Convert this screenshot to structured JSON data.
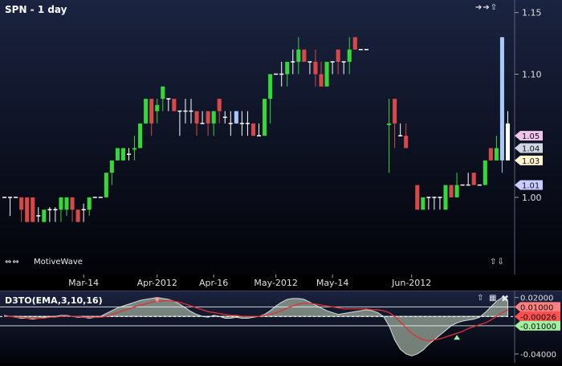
{
  "header": {
    "title": "SPN - 1 day",
    "brand": "MotiveWave"
  },
  "indicator": {
    "title": "D3TO(EMA,3,10,16)"
  },
  "icons": {
    "nav_left_right": "double-arrow-left-right-icon",
    "nav_up_down": "arrow-up-down-icon",
    "panel_close": "close-icon",
    "panel_maximize": "maximize-icon"
  },
  "colors": {
    "background_top": "#1a2340",
    "background_bottom": "#020308",
    "up_candle": "#37d63a",
    "down_candle": "#d94848",
    "highlight_candle": "#a8c8f8",
    "axis_text": "#e0e0e0",
    "indicator_fill": "#9aa89a",
    "indicator_line": "#e03030",
    "indicator_band": "#ffffff"
  },
  "chart_data": [
    {
      "type": "candlestick",
      "title": "SPN - 1 day",
      "price_axis": {
        "ticks": [
          "1.15",
          "1.10",
          "1.05",
          "1.00"
        ],
        "ylim": [
          0.94,
          1.155
        ]
      },
      "date_labels": [
        "Mar-14",
        "Apr-2012",
        "Apr-16",
        "May-2012",
        "May-14",
        "Jun-2012"
      ],
      "price_tags": [
        {
          "label": "1.05",
          "value": 1.05,
          "color": "#f0c4ec"
        },
        {
          "label": "1.04",
          "value": 1.04,
          "color": "#d0d8e4"
        },
        {
          "label": "1.03",
          "value": 1.03,
          "color": "#fff4d0"
        },
        {
          "label": "1.01",
          "value": 1.01,
          "color": "#c8ccff"
        }
      ],
      "candles": [
        {
          "o": 1.0,
          "h": 1.0,
          "l": 1.0,
          "c": 1.0,
          "s": "flat"
        },
        {
          "o": 1.0,
          "h": 1.0,
          "l": 0.985,
          "c": 1.0,
          "s": "flat"
        },
        {
          "o": 1.0,
          "h": 1.0,
          "l": 1.0,
          "c": 1.0,
          "s": "flat"
        },
        {
          "o": 1.0,
          "h": 1.0,
          "l": 0.98,
          "c": 0.99,
          "s": "down"
        },
        {
          "o": 1.0,
          "h": 1.0,
          "l": 0.985,
          "c": 0.98,
          "s": "down"
        },
        {
          "o": 1.0,
          "h": 1.0,
          "l": 0.98,
          "c": 0.98,
          "s": "down"
        },
        {
          "o": 0.985,
          "h": 0.992,
          "l": 0.98,
          "c": 0.985,
          "s": "flat"
        },
        {
          "o": 0.98,
          "h": 0.99,
          "l": 0.98,
          "c": 0.99,
          "s": "up"
        },
        {
          "o": 0.99,
          "h": 0.992,
          "l": 0.98,
          "c": 0.99,
          "s": "flat"
        },
        {
          "o": 0.99,
          "h": 0.992,
          "l": 0.98,
          "c": 0.99,
          "s": "flat"
        },
        {
          "o": 0.99,
          "h": 1.0,
          "l": 0.98,
          "c": 1.0,
          "s": "up"
        },
        {
          "o": 0.99,
          "h": 1.0,
          "l": 0.985,
          "c": 1.0,
          "s": "up"
        },
        {
          "o": 1.0,
          "h": 1.0,
          "l": 0.98,
          "c": 0.99,
          "s": "down"
        },
        {
          "o": 0.99,
          "h": 0.99,
          "l": 0.98,
          "c": 0.98,
          "s": "down"
        },
        {
          "o": 0.99,
          "h": 0.995,
          "l": 0.98,
          "c": 0.99,
          "s": "flat"
        },
        {
          "o": 0.99,
          "h": 1.0,
          "l": 0.985,
          "c": 1.0,
          "s": "up"
        },
        {
          "o": 1.0,
          "h": 1.0,
          "l": 1.0,
          "c": 1.0,
          "s": "flat"
        },
        {
          "o": 1.0,
          "h": 1.0,
          "l": 1.0,
          "c": 1.0,
          "s": "flat"
        },
        {
          "o": 1.0,
          "h": 1.02,
          "l": 1.0,
          "c": 1.02,
          "s": "up"
        },
        {
          "o": 1.02,
          "h": 1.03,
          "l": 1.01,
          "c": 1.03,
          "s": "up"
        },
        {
          "o": 1.03,
          "h": 1.04,
          "l": 1.03,
          "c": 1.04,
          "s": "up"
        },
        {
          "o": 1.03,
          "h": 1.04,
          "l": 1.03,
          "c": 1.04,
          "s": "up"
        },
        {
          "o": 1.04,
          "h": 1.04,
          "l": 1.03,
          "c": 1.035,
          "s": "flat"
        },
        {
          "o": 1.04,
          "h": 1.05,
          "l": 1.03,
          "c": 1.04,
          "s": "up"
        },
        {
          "o": 1.04,
          "h": 1.06,
          "l": 1.04,
          "c": 1.06,
          "s": "up"
        },
        {
          "o": 1.06,
          "h": 1.08,
          "l": 1.06,
          "c": 1.08,
          "s": "up"
        },
        {
          "o": 1.08,
          "h": 1.08,
          "l": 1.05,
          "c": 1.06,
          "s": "down"
        },
        {
          "o": 1.07,
          "h": 1.08,
          "l": 1.06,
          "c": 1.075,
          "s": "up"
        },
        {
          "o": 1.08,
          "h": 1.09,
          "l": 1.07,
          "c": 1.09,
          "s": "up"
        },
        {
          "o": 1.08,
          "h": 1.08,
          "l": 1.07,
          "c": 1.08,
          "s": "flat"
        },
        {
          "o": 1.08,
          "h": 1.08,
          "l": 1.07,
          "c": 1.07,
          "s": "down"
        },
        {
          "o": 1.07,
          "h": 1.07,
          "l": 1.05,
          "c": 1.07,
          "s": "flat"
        },
        {
          "o": 1.07,
          "h": 1.08,
          "l": 1.06,
          "c": 1.07,
          "s": "flat"
        },
        {
          "o": 1.07,
          "h": 1.08,
          "l": 1.06,
          "c": 1.07,
          "s": "flat"
        },
        {
          "o": 1.07,
          "h": 1.07,
          "l": 1.05,
          "c": 1.06,
          "s": "down"
        },
        {
          "o": 1.06,
          "h": 1.07,
          "l": 1.06,
          "c": 1.06,
          "s": "flat"
        },
        {
          "o": 1.07,
          "h": 1.07,
          "l": 1.05,
          "c": 1.06,
          "s": "down"
        },
        {
          "o": 1.06,
          "h": 1.07,
          "l": 1.05,
          "c": 1.07,
          "s": "up"
        },
        {
          "o": 1.08,
          "h": 1.08,
          "l": 1.06,
          "c": 1.07,
          "s": "down"
        },
        {
          "o": 1.07,
          "h": 1.07,
          "l": 1.06,
          "c": 1.065,
          "s": "flat"
        },
        {
          "o": 1.07,
          "h": 1.07,
          "l": 1.05,
          "c": 1.06,
          "s": "flat"
        },
        {
          "o": 1.06,
          "h": 1.07,
          "l": 1.06,
          "c": 1.07,
          "s": "highlight"
        },
        {
          "o": 1.06,
          "h": 1.07,
          "l": 1.05,
          "c": 1.06,
          "s": "flat"
        },
        {
          "o": 1.06,
          "h": 1.07,
          "l": 1.05,
          "c": 1.06,
          "s": "flat"
        },
        {
          "o": 1.06,
          "h": 1.06,
          "l": 1.05,
          "c": 1.05,
          "s": "down"
        },
        {
          "o": 1.05,
          "h": 1.06,
          "l": 1.05,
          "c": 1.05,
          "s": "flat"
        },
        {
          "o": 1.05,
          "h": 1.08,
          "l": 1.05,
          "c": 1.08,
          "s": "up"
        },
        {
          "o": 1.08,
          "h": 1.1,
          "l": 1.06,
          "c": 1.1,
          "s": "up"
        },
        {
          "o": 1.1,
          "h": 1.1,
          "l": 1.1,
          "c": 1.1,
          "s": "flat"
        },
        {
          "o": 1.1,
          "h": 1.11,
          "l": 1.09,
          "c": 1.1,
          "s": "flat"
        },
        {
          "o": 1.1,
          "h": 1.11,
          "l": 1.09,
          "c": 1.11,
          "s": "up"
        },
        {
          "o": 1.11,
          "h": 1.12,
          "l": 1.1,
          "c": 1.11,
          "s": "flat"
        },
        {
          "o": 1.11,
          "h": 1.13,
          "l": 1.1,
          "c": 1.12,
          "s": "up"
        },
        {
          "o": 1.12,
          "h": 1.12,
          "l": 1.11,
          "c": 1.11,
          "s": "down"
        },
        {
          "o": 1.11,
          "h": 1.11,
          "l": 1.1,
          "c": 1.11,
          "s": "flat"
        },
        {
          "o": 1.11,
          "h": 1.12,
          "l": 1.09,
          "c": 1.1,
          "s": "down"
        },
        {
          "o": 1.1,
          "h": 1.11,
          "l": 1.09,
          "c": 1.09,
          "s": "down"
        },
        {
          "o": 1.09,
          "h": 1.11,
          "l": 1.09,
          "c": 1.11,
          "s": "up"
        },
        {
          "o": 1.11,
          "h": 1.11,
          "l": 1.1,
          "c": 1.11,
          "s": "flat"
        },
        {
          "o": 1.12,
          "h": 1.12,
          "l": 1.1,
          "c": 1.11,
          "s": "down"
        },
        {
          "o": 1.11,
          "h": 1.11,
          "l": 1.1,
          "c": 1.11,
          "s": "flat"
        },
        {
          "o": 1.11,
          "h": 1.13,
          "l": 1.1,
          "c": 1.12,
          "s": "up"
        },
        {
          "o": 1.13,
          "h": 1.13,
          "l": 1.12,
          "c": 1.12,
          "s": "down"
        },
        {
          "o": 1.12,
          "h": 1.12,
          "l": 1.12,
          "c": 1.12,
          "s": "flat"
        },
        {
          "o": 1.12,
          "h": 1.12,
          "l": 1.12,
          "c": 1.12,
          "s": "flat"
        },
        {
          "o": null,
          "h": null,
          "l": null,
          "c": null,
          "s": "gap"
        },
        {
          "o": null,
          "h": null,
          "l": null,
          "c": null,
          "s": "gap"
        },
        {
          "o": null,
          "h": null,
          "l": null,
          "c": null,
          "s": "gap"
        },
        {
          "o": 1.06,
          "h": 1.08,
          "l": 1.02,
          "c": 1.06,
          "s": "up"
        },
        {
          "o": 1.08,
          "h": 1.08,
          "l": 1.04,
          "c": 1.06,
          "s": "down"
        },
        {
          "o": 1.06,
          "h": 1.06,
          "l": 1.05,
          "c": 1.05,
          "s": "flat"
        },
        {
          "o": 1.05,
          "h": 1.06,
          "l": 1.04,
          "c": 1.04,
          "s": "down"
        },
        {
          "o": null,
          "h": null,
          "l": null,
          "c": null,
          "s": "gap"
        },
        {
          "o": 1.01,
          "h": 1.01,
          "l": 0.99,
          "c": 0.99,
          "s": "down"
        },
        {
          "o": 0.99,
          "h": 1.0,
          "l": 0.99,
          "c": 1.0,
          "s": "up"
        },
        {
          "o": 1.0,
          "h": 1.0,
          "l": 0.99,
          "c": 1.0,
          "s": "flat"
        },
        {
          "o": 1.0,
          "h": 1.0,
          "l": 0.99,
          "c": 1.0,
          "s": "flat"
        },
        {
          "o": 1.0,
          "h": 1.0,
          "l": 0.99,
          "c": 1.0,
          "s": "flat"
        },
        {
          "o": 0.99,
          "h": 1.01,
          "l": 0.99,
          "c": 1.01,
          "s": "up"
        },
        {
          "o": 1.01,
          "h": 1.01,
          "l": 1.0,
          "c": 1.0,
          "s": "down"
        },
        {
          "o": 1.0,
          "h": 1.02,
          "l": 1.0,
          "c": 1.01,
          "s": "up"
        },
        {
          "o": 1.01,
          "h": 1.01,
          "l": 1.01,
          "c": 1.01,
          "s": "flat"
        },
        {
          "o": 1.01,
          "h": 1.02,
          "l": 1.01,
          "c": 1.01,
          "s": "flat"
        },
        {
          "o": 1.02,
          "h": 1.02,
          "l": 1.01,
          "c": 1.01,
          "s": "down"
        },
        {
          "o": 1.01,
          "h": 1.01,
          "l": 1.01,
          "c": 1.01,
          "s": "flat"
        },
        {
          "o": 1.01,
          "h": 1.03,
          "l": 1.01,
          "c": 1.03,
          "s": "up"
        },
        {
          "o": 1.04,
          "h": 1.04,
          "l": 1.03,
          "c": 1.03,
          "s": "down"
        },
        {
          "o": 1.03,
          "h": 1.05,
          "l": 1.03,
          "c": 1.04,
          "s": "up"
        },
        {
          "o": 1.03,
          "h": 1.13,
          "l": 1.02,
          "c": 1.13,
          "s": "highlight"
        },
        {
          "o": 1.06,
          "h": 1.07,
          "l": 1.03,
          "c": 1.03,
          "s": "down_white"
        }
      ]
    },
    {
      "type": "area",
      "title": "D3TO(EMA,3,10,16)",
      "y_ticks": [
        "0.02000",
        "0.01000",
        "-0.00026",
        "-0.01000",
        "-0.04000"
      ],
      "ylim": [
        -0.046,
        0.024
      ],
      "reference_levels": [
        0.01,
        -0.01
      ],
      "current_value": -0.00026,
      "oscillator": [
        0.001,
        0.0,
        -0.001,
        -0.002,
        -0.002,
        -0.003,
        -0.002,
        -0.001,
        -0.001,
        0.0,
        0.001,
        0.001,
        0.0,
        -0.001,
        -0.001,
        -0.002,
        -0.001,
        0.0,
        0.003,
        0.006,
        0.009,
        0.011,
        0.013,
        0.015,
        0.017,
        0.018,
        0.019,
        0.02,
        0.019,
        0.018,
        0.016,
        0.013,
        0.009,
        0.005,
        0.002,
        0.0,
        -0.001,
        0.001,
        0.0,
        -0.002,
        -0.002,
        -0.001,
        -0.002,
        -0.002,
        -0.001,
        0.0,
        0.002,
        0.006,
        0.011,
        0.015,
        0.018,
        0.019,
        0.019,
        0.018,
        0.015,
        0.012,
        0.009,
        0.006,
        0.004,
        0.002,
        0.003,
        0.004,
        0.005,
        0.006,
        0.007,
        0.006,
        0.004,
        0.0,
        -0.01,
        -0.025,
        -0.035,
        -0.04,
        -0.042,
        -0.04,
        -0.036,
        -0.03,
        -0.025,
        -0.02,
        -0.015,
        -0.01,
        -0.007,
        -0.005,
        -0.004,
        -0.003,
        -0.001,
        0.004,
        0.01,
        0.016,
        0.02,
        0.016
      ],
      "signal": [
        0.0,
        0.0,
        -0.001,
        -0.001,
        -0.002,
        -0.002,
        -0.002,
        -0.002,
        -0.001,
        -0.001,
        0.0,
        0.0,
        0.0,
        0.0,
        -0.001,
        -0.001,
        -0.001,
        -0.001,
        0.0,
        0.002,
        0.004,
        0.006,
        0.008,
        0.01,
        0.012,
        0.013,
        0.015,
        0.016,
        0.016,
        0.017,
        0.016,
        0.015,
        0.013,
        0.011,
        0.009,
        0.007,
        0.005,
        0.004,
        0.003,
        0.002,
        0.001,
        0.001,
        0.0,
        0.0,
        0.0,
        0.0,
        0.001,
        0.002,
        0.004,
        0.006,
        0.009,
        0.011,
        0.013,
        0.014,
        0.014,
        0.013,
        0.012,
        0.011,
        0.01,
        0.009,
        0.008,
        0.008,
        0.008,
        0.008,
        0.008,
        0.007,
        0.007,
        0.006,
        0.004,
        0.0,
        -0.006,
        -0.012,
        -0.018,
        -0.022,
        -0.025,
        -0.026,
        -0.025,
        -0.024,
        -0.022,
        -0.02,
        -0.018,
        -0.016,
        -0.013,
        -0.011,
        -0.009,
        -0.007,
        -0.004,
        0.0,
        0.004,
        0.007
      ]
    }
  ]
}
